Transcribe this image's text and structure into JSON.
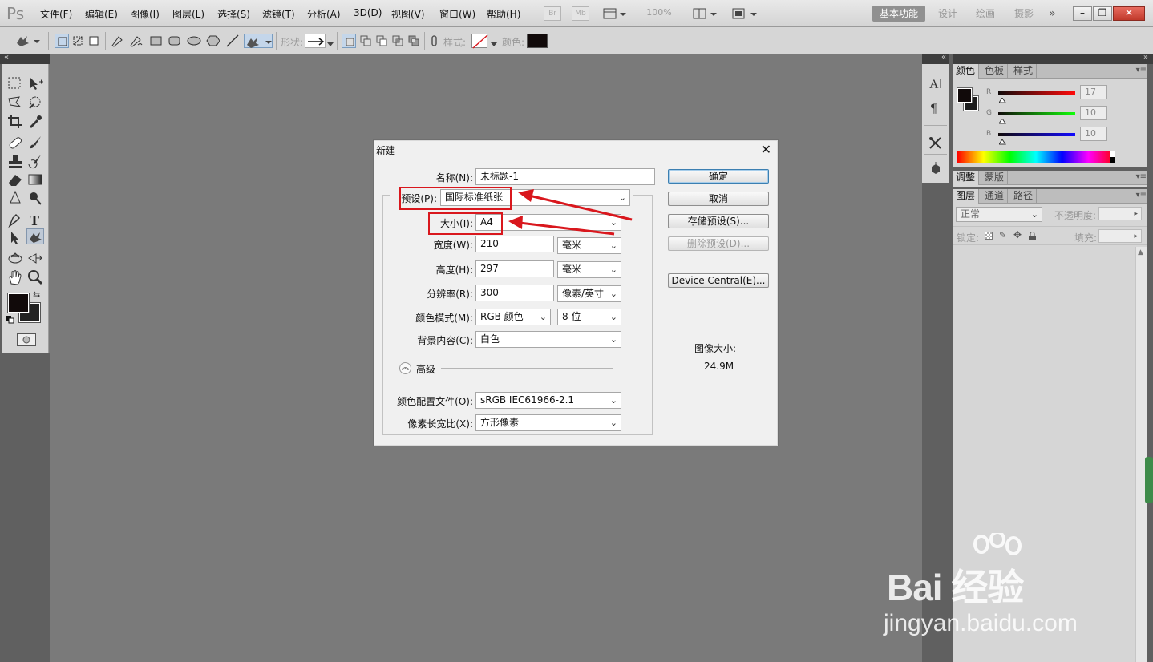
{
  "app": {
    "logo": "Ps",
    "menu": [
      "文件(F)",
      "编辑(E)",
      "图像(I)",
      "图层(L)",
      "选择(S)",
      "滤镜(T)",
      "分析(A)",
      "3D(D)",
      "视图(V)",
      "窗口(W)",
      "帮助(H)"
    ],
    "mini_buttons": [
      "Br",
      "Mb"
    ],
    "zoom": "100%",
    "workspaces": [
      "基本功能",
      "设计",
      "绘画",
      "摄影",
      "»"
    ]
  },
  "options": {
    "shape_label": "形状:",
    "style_label": "样式:",
    "color_label": "颜色:"
  },
  "color_panel": {
    "tabs": [
      "颜色",
      "色板",
      "样式"
    ],
    "channels": [
      {
        "label": "R",
        "value": "17"
      },
      {
        "label": "G",
        "value": "10"
      },
      {
        "label": "B",
        "value": "10"
      }
    ],
    "foreground": "#110a0a"
  },
  "adjust_panel": {
    "tabs": [
      "调整",
      "蒙版"
    ]
  },
  "layers_panel": {
    "tabs": [
      "图层",
      "通道",
      "路径"
    ],
    "blend_mode": "正常",
    "opacity_label": "不透明度:",
    "lock_label": "锁定:",
    "fill_label": "填充:"
  },
  "dialog": {
    "title": "新建",
    "name_label": "名称(N):",
    "name_value": "未标题-1",
    "preset_label": "预设(P):",
    "preset_value": "国际标准纸张",
    "size_label": "大小(I):",
    "size_value": "A4",
    "width_label": "宽度(W):",
    "width_value": "210",
    "width_unit": "毫米",
    "height_label": "高度(H):",
    "height_value": "297",
    "height_unit": "毫米",
    "resolution_label": "分辨率(R):",
    "resolution_value": "300",
    "resolution_unit": "像素/英寸",
    "color_mode_label": "颜色模式(M):",
    "color_mode_value": "RGB 颜色",
    "bit_depth_value": "8 位",
    "background_label": "背景内容(C):",
    "background_value": "白色",
    "advanced_label": "高级",
    "profile_label": "颜色配置文件(O):",
    "profile_value": "sRGB IEC61966-2.1",
    "aspect_label": "像素长宽比(X):",
    "aspect_value": "方形像素",
    "buttons": {
      "ok": "确定",
      "cancel": "取消",
      "save_preset": "存储预设(S)...",
      "delete_preset": "删除预设(D)...",
      "device_central": "Device Central(E)..."
    },
    "image_size_label": "图像大小:",
    "image_size_value": "24.9M"
  },
  "watermark": {
    "big": "Bai 经验",
    "small": "jingyan.baidu.com"
  },
  "colors": {
    "annotation_red": "#d9171d",
    "canvas_gray": "#7a7a7a"
  }
}
